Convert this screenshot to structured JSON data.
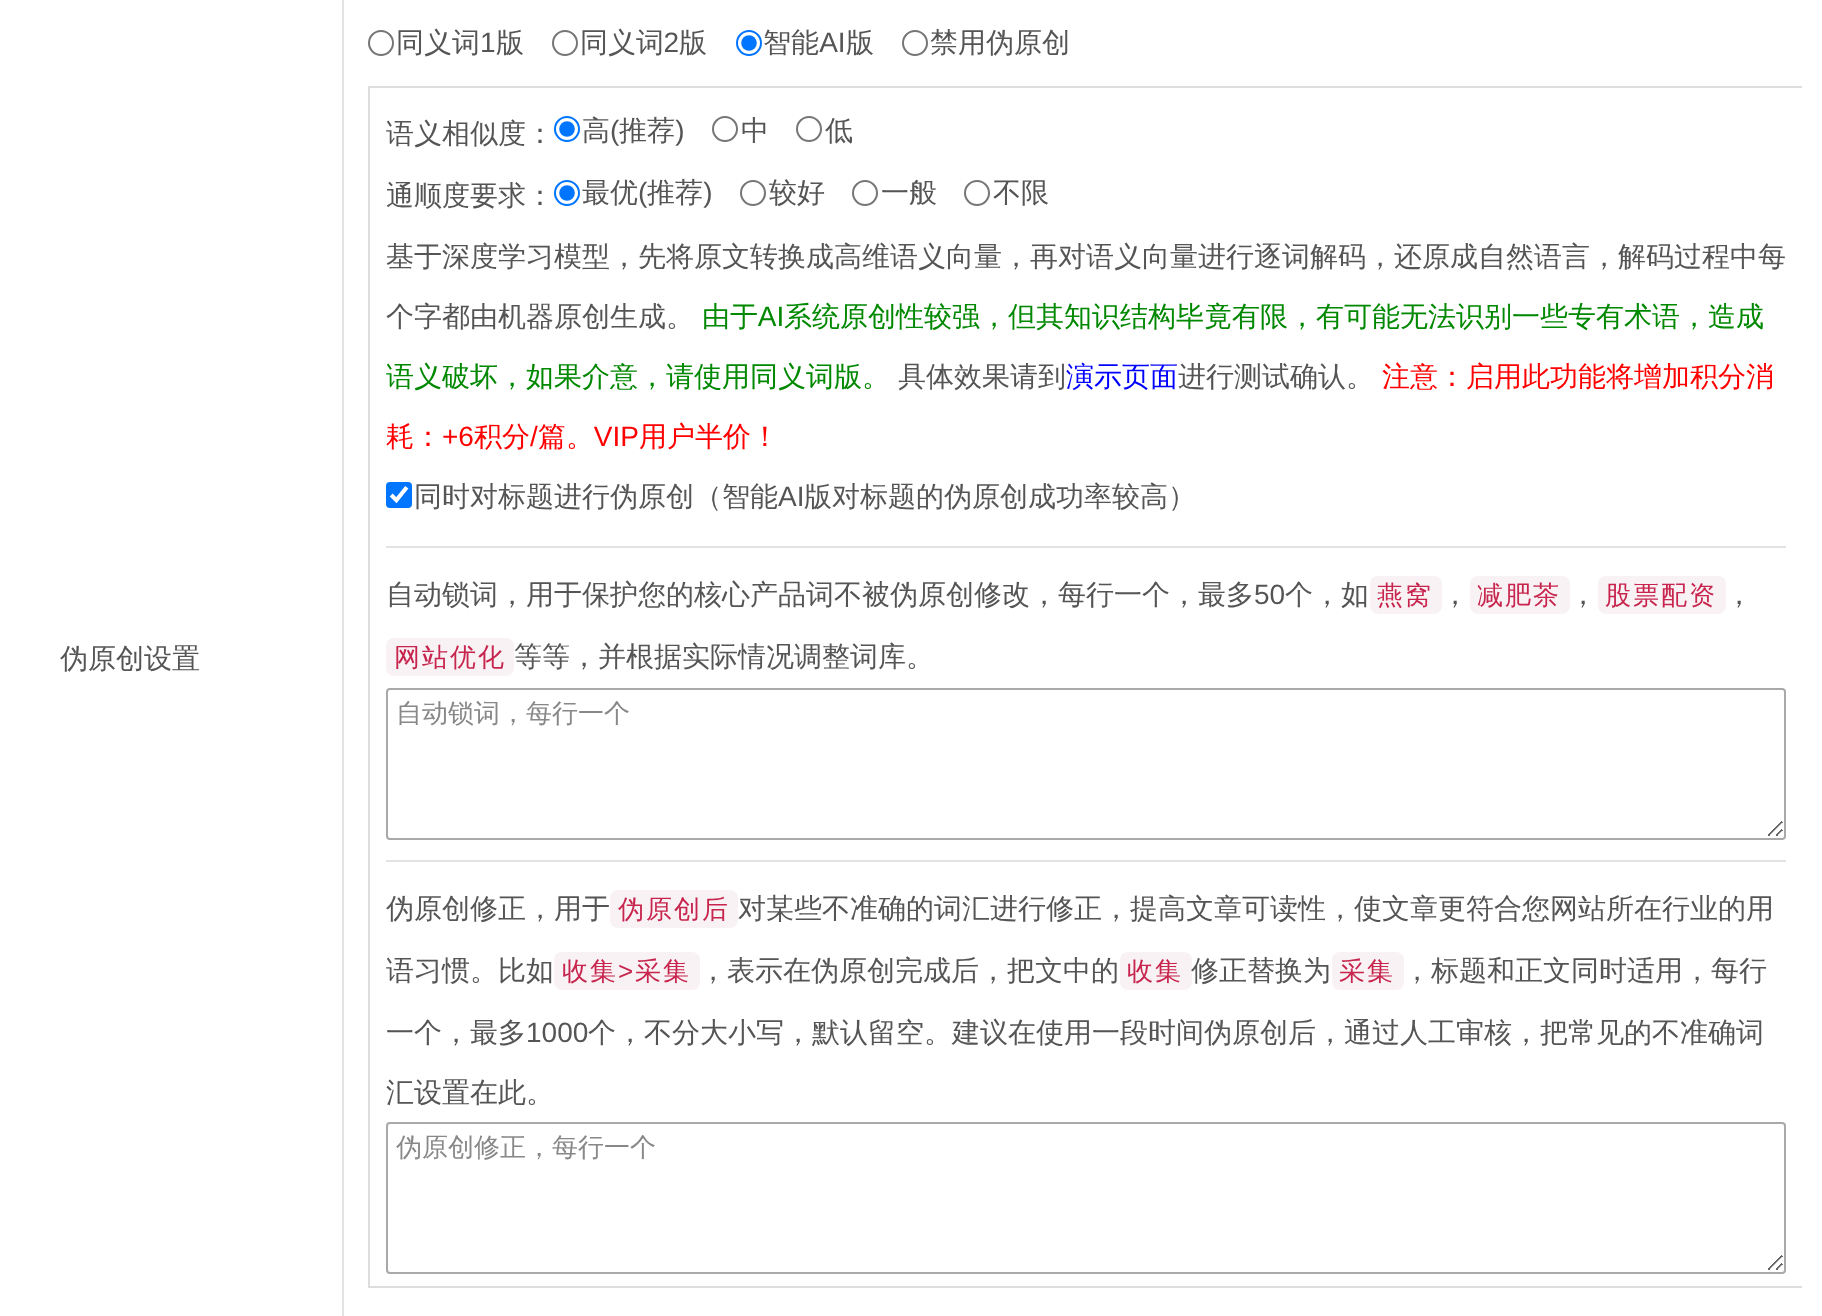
{
  "section_label": "伪原创设置",
  "mode_options": [
    {
      "label": "同义词1版",
      "selected": false
    },
    {
      "label": "同义词2版",
      "selected": false
    },
    {
      "label": "智能AI版",
      "selected": true
    },
    {
      "label": "禁用伪原创",
      "selected": false
    }
  ],
  "similarity": {
    "label": "语义相似度：",
    "options": [
      {
        "label": "高(推荐)",
        "selected": true
      },
      {
        "label": "中",
        "selected": false
      },
      {
        "label": "低",
        "selected": false
      }
    ]
  },
  "fluency": {
    "label": "通顺度要求：",
    "options": [
      {
        "label": "最优(推荐)",
        "selected": true
      },
      {
        "label": "较好",
        "selected": false
      },
      {
        "label": "一般",
        "selected": false
      },
      {
        "label": "不限",
        "selected": false
      }
    ]
  },
  "ai_description": [
    {
      "kind": "plain",
      "text": "基于深度学习模型，先将原文转换成高维语义向量，再对语义向量进行逐词解码，还原成自然语言，解码过程中每个字都由机器原创生成。 "
    },
    {
      "kind": "green",
      "text": "由于AI系统原创性较强，但其知识结构毕竟有限，有可能无法识别一些专有术语，造成语义破坏，如果介意，请使用同义词版。"
    },
    {
      "kind": "plain",
      "text": " 具体效果请到"
    },
    {
      "kind": "link",
      "text": "演示页面"
    },
    {
      "kind": "plain",
      "text": "进行测试确认。 "
    },
    {
      "kind": "red",
      "text": "注意：启用此功能将增加积分消耗：+6积分/篇。VIP用户半价！"
    }
  ],
  "title_option": {
    "label": "同时对标题进行伪原创（智能AI版对标题的伪原创成功率较高）",
    "checked": true
  },
  "lock_words": {
    "description": [
      {
        "kind": "plain",
        "text": "自动锁词，用于保护您的核心产品词不被伪原创修改，每行一个，最多50个，如"
      },
      {
        "kind": "code",
        "text": "燕窝"
      },
      {
        "kind": "plain",
        "text": "，"
      },
      {
        "kind": "code",
        "text": "减肥茶"
      },
      {
        "kind": "plain",
        "text": "，"
      },
      {
        "kind": "code",
        "text": "股票配资"
      },
      {
        "kind": "plain",
        "text": "，"
      },
      {
        "kind": "code",
        "text": "网站优化"
      },
      {
        "kind": "plain",
        "text": "等等，并根据实际情况调整词库。"
      }
    ],
    "placeholder": "自动锁词，每行一个"
  },
  "correction": {
    "description": [
      {
        "kind": "plain",
        "text": "伪原创修正，用于"
      },
      {
        "kind": "code",
        "text": "伪原创后"
      },
      {
        "kind": "plain",
        "text": "对某些不准确的词汇进行修正，提高文章可读性，使文章更符合您网站所在行业的用语习惯。比如"
      },
      {
        "kind": "code",
        "text": "收集>采集"
      },
      {
        "kind": "plain",
        "text": "，表示在伪原创完成后，把文中的"
      },
      {
        "kind": "code",
        "text": "收集"
      },
      {
        "kind": "plain",
        "text": "修正替换为"
      },
      {
        "kind": "code",
        "text": "采集"
      },
      {
        "kind": "plain",
        "text": "，标题和正文同时适用，每行一个，最多1000个，不分大小写，默认留空。建议在使用一段时间伪原创后，通过人工审核，把常见的不准确词汇设置在此。"
      }
    ],
    "placeholder": "伪原创修正，每行一个"
  }
}
